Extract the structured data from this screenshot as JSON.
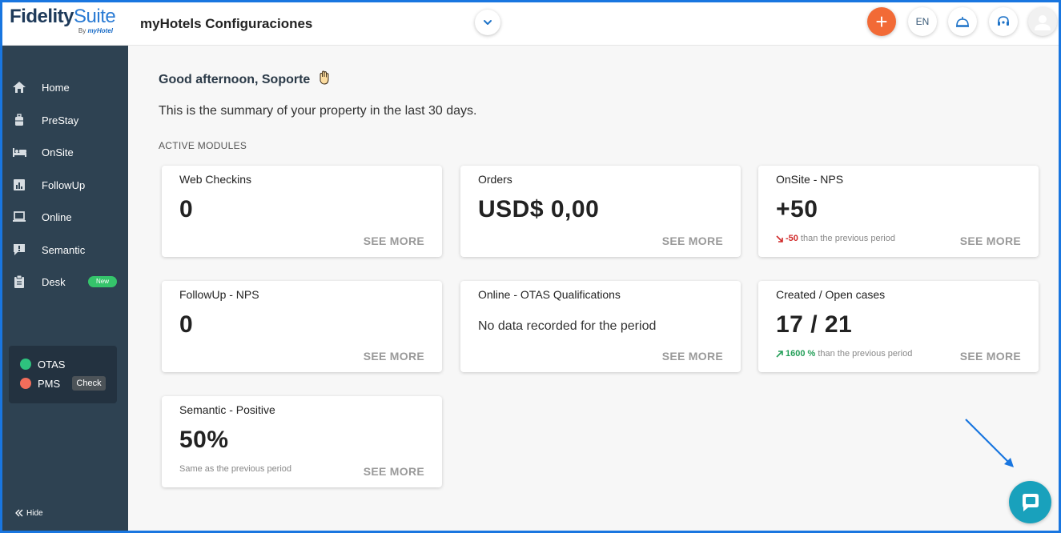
{
  "header": {
    "logo_bold": "Fidelity",
    "logo_light": "Suite",
    "logo_by": "By",
    "logo_brand": "myHotel",
    "title": "myHotels Configuraciones",
    "dropdown_icon": "chevron-down-icon",
    "add_label": "+",
    "lang_label": "EN",
    "accent_color": "#f26a36"
  },
  "sidebar": {
    "items": [
      {
        "label": "Home",
        "icon": "home-icon"
      },
      {
        "label": "PreStay",
        "icon": "luggage-icon"
      },
      {
        "label": "OnSite",
        "icon": "bed-icon"
      },
      {
        "label": "FollowUp",
        "icon": "bar-chart-icon"
      },
      {
        "label": "Online",
        "icon": "laptop-icon"
      },
      {
        "label": "Semantic",
        "icon": "speech-bubble-icon"
      },
      {
        "label": "Desk",
        "icon": "clipboard-icon",
        "badge": "New"
      }
    ],
    "integrations": [
      {
        "label": "OTAS",
        "status_color": "#2ec27e"
      },
      {
        "label": "PMS",
        "status_color": "#f26d5b",
        "action": "Check"
      }
    ],
    "hide_label": "Hide",
    "bg_color": "#2e4252"
  },
  "main": {
    "greeting": "Good afternoon, Soporte",
    "summary": "This is the summary of your property in the last 30 days.",
    "modules_title": "ACTIVE MODULES",
    "see_more": "SEE MORE",
    "cards": [
      {
        "title": "Web Checkins",
        "value": "0"
      },
      {
        "title": "Orders",
        "value": "USD$ 0,00"
      },
      {
        "title": "OnSite - NPS",
        "value": "+50",
        "compare_value": "-50",
        "compare_text": "than the previous period",
        "trend": "down"
      },
      {
        "title": "FollowUp - NPS",
        "value": "0"
      },
      {
        "title": "Online - OTAS Qualifications",
        "message": "No data recorded for the period"
      },
      {
        "title": "Created / Open cases",
        "value": "17 / 21",
        "compare_value": "1600 %",
        "compare_text": "than the previous period",
        "trend": "up"
      },
      {
        "title": "Semantic - Positive",
        "value": "50%",
        "compare_text": "Same as the previous period"
      }
    ]
  },
  "chat": {
    "icon": "chat-bubble-icon",
    "color": "#19a1bc"
  }
}
